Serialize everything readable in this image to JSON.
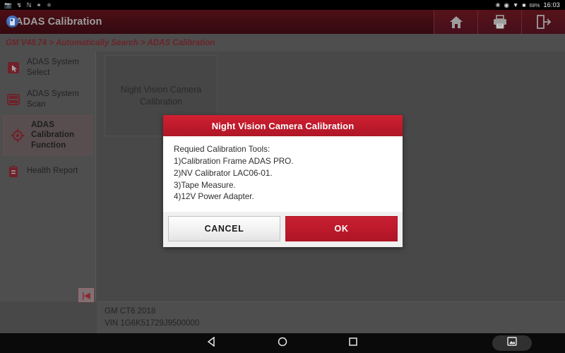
{
  "status_bar": {
    "icons": [
      "screenshot-icon",
      "usb-debug-icon",
      "network-icon",
      "usb-icon",
      "settings-icon"
    ],
    "bluetooth_icon": "bluetooth-icon",
    "rotation_icon": "screen-rotation-icon",
    "wifi_icon": "wifi-icon",
    "battery_icon": "battery-icon",
    "battery_level": "68%",
    "time": "16:03"
  },
  "title_bar": {
    "app_title": "ADAS Calibration",
    "app_icon": "app-icon",
    "actions": [
      {
        "name": "home-button",
        "icon": "home-icon"
      },
      {
        "name": "print-button",
        "icon": "printer-icon"
      },
      {
        "name": "exit-button",
        "icon": "exit-icon"
      }
    ]
  },
  "breadcrumb": {
    "text": "GM V48.74 > Automatically Search > ADAS Calibration"
  },
  "sidebar": {
    "items": [
      {
        "label": "ADAS System Select",
        "icon": "cursor-select-icon",
        "active": false
      },
      {
        "label": "ADAS System Scan",
        "icon": "system-scan-icon",
        "active": false
      },
      {
        "label": "ADAS Calibration Function",
        "icon": "target-crosshair-icon",
        "active": true
      },
      {
        "label": "Health Report",
        "icon": "clipboard-report-icon",
        "active": false
      }
    ],
    "collapse_label": "|◀"
  },
  "main": {
    "cards": [
      {
        "label": "Night Vision Camera Calibration"
      }
    ]
  },
  "vehicle_info": {
    "model": "GM CT6 2018",
    "vin": "VIN 1G6K51729J9500000"
  },
  "dialog": {
    "title": "Night Vision Camera Calibration",
    "lines": [
      "Requied Calibration Tools:",
      "1)Calibration Frame ADAS PRO.",
      "2)NV Calibrator LAC06-01.",
      "3)Tape Measure.",
      "4)12V Power Adapter."
    ],
    "cancel_label": "CANCEL",
    "ok_label": "OK"
  },
  "nav_bar": {
    "back_icon": "back-triangle-icon",
    "home_icon": "home-circle-icon",
    "recents_icon": "recents-square-icon",
    "screenshot_icon": "screenshot-image-icon"
  },
  "colors": {
    "brand_red": "#bd1a2b",
    "title_bar": "#3d0c12",
    "breadcrumb_text": "#9b1f29",
    "panel_gray": "#6a6a6a"
  }
}
